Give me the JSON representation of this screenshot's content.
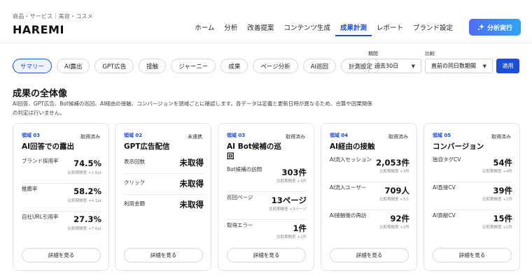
{
  "header": {
    "category": "商品・サービス｜美容・コスメ",
    "brand": "HAREMI",
    "nav": [
      {
        "label": "ホーム",
        "active": false
      },
      {
        "label": "分析",
        "active": false
      },
      {
        "label": "改善提案",
        "active": false
      },
      {
        "label": "コンテンツ生成",
        "active": false
      },
      {
        "label": "成果計測",
        "active": true
      },
      {
        "label": "レポート",
        "active": false
      },
      {
        "label": "ブランド設定",
        "active": false
      }
    ],
    "run_button": "分析実行",
    "run_icon": "sparkle-icon"
  },
  "tabs": [
    {
      "label": "サマリー",
      "active": true
    },
    {
      "label": "AI露出",
      "active": false
    },
    {
      "label": "GPT広告",
      "active": false
    },
    {
      "label": "接触",
      "active": false
    },
    {
      "label": "ジャーニー",
      "active": false
    },
    {
      "label": "成果",
      "active": false
    },
    {
      "label": "ページ分析",
      "active": false
    },
    {
      "label": "AI巡回",
      "active": false
    },
    {
      "label": "計測設定",
      "active": false
    }
  ],
  "filters": {
    "period_label": "期間",
    "period_value": "過去30日",
    "compare_label": "比較",
    "compare_value": "直前の同日数期間",
    "apply": "適用"
  },
  "section": {
    "title": "成果の全体像",
    "description": "AI回答、GPT広告、Bot候補の巡回、AI経由の接触、コンバージョンを領域ごとに確認します。各データは定義と更新日時が異なるため、合算や因果関係の判定は行いません。"
  },
  "colors": {
    "accent": "#1d4ed8",
    "border": "#e3e5ea"
  },
  "cards": [
    {
      "area": "領域 03",
      "status": "取得済み",
      "title": "AI回答での露出",
      "detail": "詳細を見る",
      "rows": [
        {
          "label": "ブランド採用率",
          "value": "74.5%",
          "note": "比較期間差 +1.6pt"
        },
        {
          "label": "推薦率",
          "value": "58.2%",
          "note": "比較期間差 +4.1pt"
        },
        {
          "label": "自社URL引用率",
          "value": "27.3%",
          "note": "比較期間差 +7.6pt"
        }
      ]
    },
    {
      "area": "領域 02",
      "status": "未連携",
      "title": "GPT広告配信",
      "detail": "詳細を見る",
      "rows": [
        {
          "label": "表示回数",
          "value": "未取得",
          "note": ""
        },
        {
          "label": "クリック",
          "value": "未取得",
          "note": ""
        },
        {
          "label": "利用金額",
          "value": "未取得",
          "note": ""
        }
      ]
    },
    {
      "area": "領域 03",
      "status": "取得済み",
      "title": "AI Bot候補の巡回",
      "detail": "詳細を見る",
      "rows": [
        {
          "label": "Bot候補の訪問",
          "value": "303件",
          "note": "比較期間差 +3件"
        },
        {
          "label": "巡回ページ",
          "value": "13ページ",
          "note": "比較期間差 +3ページ"
        },
        {
          "label": "取得エラー",
          "value": "1件",
          "note": "比較期間差 +1件"
        }
      ]
    },
    {
      "area": "領域 04",
      "status": "取得済み",
      "title": "AI経由の接触",
      "detail": "詳細を見る",
      "rows": [
        {
          "label": "AI流入セッション",
          "value": "2,053件",
          "note": "比較期間差 +3件"
        },
        {
          "label": "AI流入ユーザー",
          "value": "709人",
          "note": "比較期間差 +3人"
        },
        {
          "label": "AI接触後の再訪",
          "value": "92件",
          "note": "比較期間差 +2件"
        }
      ]
    },
    {
      "area": "領域 05",
      "status": "取得済み",
      "title": "コンバージョン",
      "detail": "詳細を見る",
      "rows": [
        {
          "label": "独自タグCV",
          "value": "54件",
          "note": "比較期間差 +4件"
        },
        {
          "label": "AI直接CV",
          "value": "39件",
          "note": "比較期間差 +1件"
        },
        {
          "label": "AI貢献CV",
          "value": "15件",
          "note": "比較期間差 +1件"
        }
      ]
    }
  ]
}
